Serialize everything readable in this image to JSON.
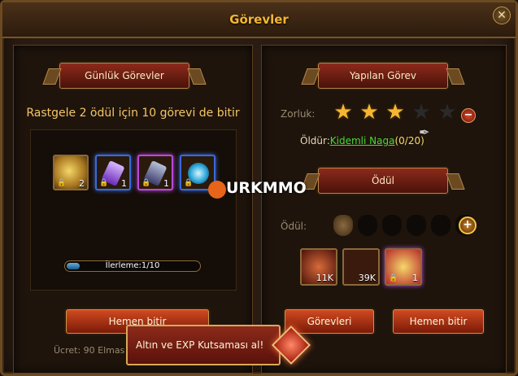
{
  "window": {
    "title": "Görevler",
    "close_icon": "close-icon"
  },
  "left": {
    "header": "Günlük Görevler",
    "task_text": "Rastgele 2 ödül için 10 görevi de bitir",
    "items": [
      {
        "icon": "gold-coin-icon",
        "count": "2",
        "locked": true
      },
      {
        "icon": "purple-crystal-icon",
        "count": "1",
        "locked": true
      },
      {
        "icon": "dark-crystal-icon",
        "count": "1",
        "locked": true
      },
      {
        "icon": "blue-orb-icon",
        "count": "",
        "locked": true
      }
    ],
    "progress": {
      "label": "İlerleme:1/10",
      "value": 0.1
    },
    "button": "Hemen bitir",
    "cost": "Ücret: 90 Elmas"
  },
  "right": {
    "header": "Yapılan Görev",
    "difficulty_label": "Zorluk:",
    "difficulty": {
      "filled": 3,
      "total": 5
    },
    "kill_prefix": "Öldür:",
    "kill_target": "Kidemli Naga",
    "kill_progress": "(0/20)",
    "reward_header": "Ödül",
    "reward_label": "Ödül:",
    "bags_total": 6,
    "rewards": [
      {
        "icon": "exp-scroll-icon",
        "count": "11K"
      },
      {
        "icon": "gold-coin-icon",
        "count": "39K"
      },
      {
        "icon": "gift-box-icon",
        "count": "1",
        "locked": true
      }
    ],
    "buttons": {
      "tasks": "Görevleri",
      "finish": "Hemen bitir"
    }
  },
  "tooltip": "Altın ve EXP Kutsaması al!",
  "watermark": "URKMMO",
  "colors": {
    "accent": "#f5b731",
    "target": "#4ad83a",
    "button": "#d04a20"
  }
}
